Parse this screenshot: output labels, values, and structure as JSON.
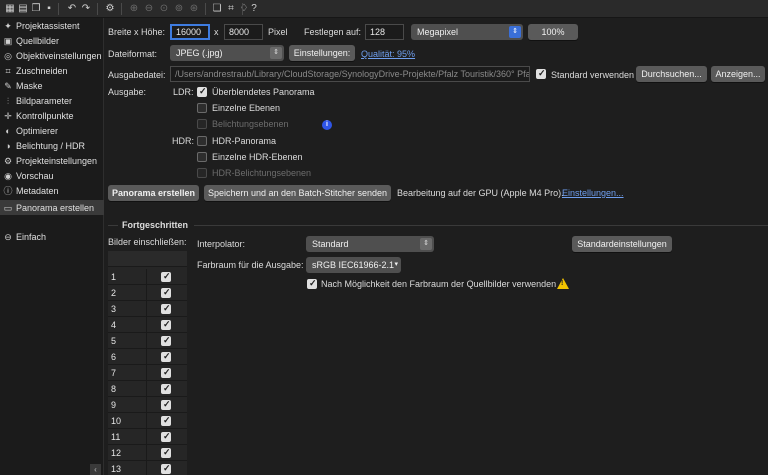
{
  "toolbar": {
    "icons": [
      "project-assistant-icon",
      "images-icon",
      "copy-icon",
      "save-icon",
      "undo-icon",
      "redo-icon",
      "settings-icon",
      "zoom-in-icon",
      "zoom-out-icon",
      "zoom-fit-icon",
      "zoom-100-icon",
      "zoom-custom-icon",
      "window-icon",
      "crop-icon",
      "hint-icon",
      "help-icon"
    ]
  },
  "sidebar": {
    "items": [
      {
        "label": "Projektassistent",
        "icon": "wand-icon",
        "glyph": "✦"
      },
      {
        "label": "Quellbilder",
        "icon": "images-icon",
        "glyph": "▣"
      },
      {
        "label": "Objektiveinstellungen",
        "icon": "lens-icon",
        "glyph": "◎"
      },
      {
        "label": "Zuschneiden",
        "icon": "crop-icon",
        "glyph": "⌗"
      },
      {
        "label": "Maske",
        "icon": "brush-icon",
        "glyph": "✎"
      },
      {
        "label": "Bildparameter",
        "icon": "sliders-icon",
        "glyph": "⫶"
      },
      {
        "label": "Kontrollpunkte",
        "icon": "crosshair-icon",
        "glyph": "✛"
      },
      {
        "label": "Optimierer",
        "icon": "optimizer-icon",
        "glyph": "◐"
      },
      {
        "label": "Belichtung / HDR",
        "icon": "exposure-icon",
        "glyph": "◑"
      },
      {
        "label": "Projekteinstellungen",
        "icon": "gear-icon",
        "glyph": "⚙"
      },
      {
        "label": "Vorschau",
        "icon": "eye-icon",
        "glyph": "◉"
      },
      {
        "label": "Metadaten",
        "icon": "info-icon",
        "glyph": "ⓘ"
      },
      {
        "label": "Panorama erstellen",
        "icon": "panorama-icon",
        "glyph": "▭"
      }
    ],
    "mode_label": "Einfach",
    "mode_glyph": "⊖"
  },
  "size": {
    "label": "Breite x Höhe:",
    "width": "16000",
    "x": "x",
    "height": "8000",
    "unit": "Pixel",
    "fix_label": "Festlegen auf:",
    "fix_value": "128",
    "megapixel_select": "Megapixel",
    "percent": "100%"
  },
  "format": {
    "label": "Dateiformat:",
    "value": "JPEG (.jpg)",
    "settings_button": "Einstellungen:",
    "quality_link": "Qualität: 95%"
  },
  "output_file": {
    "label": "Ausgabedatei:",
    "path": "/Users/andrestraub/Library/CloudStorage/SynologyDrive-Projekte/Pfalz Touristik/360° Pfal",
    "use_default": "Standard verwenden",
    "browse_button": "Durchsuchen...",
    "show_button": "Anzeigen..."
  },
  "output": {
    "label": "Ausgabe:",
    "ldr_label": "LDR:",
    "ldr": [
      {
        "label": "Überblendetes Panorama",
        "checked": true,
        "disabled": false
      },
      {
        "label": "Einzelne Ebenen",
        "checked": false,
        "disabled": false
      },
      {
        "label": "Belichtungsebenen",
        "checked": false,
        "disabled": true
      }
    ],
    "hdr_label": "HDR:",
    "hdr": [
      {
        "label": "HDR-Panorama",
        "checked": false,
        "disabled": false
      },
      {
        "label": "Einzelne HDR-Ebenen",
        "checked": false,
        "disabled": false
      },
      {
        "label": "HDR-Belichtungsebenen",
        "checked": false,
        "disabled": true
      }
    ]
  },
  "actions": {
    "create_button": "Panorama erstellen",
    "batch_button": "Speichern und an den Batch-Stitcher senden",
    "gpu_text": "Bearbeitung auf der GPU (Apple M4 Pro).",
    "gpu_link": "Einstellungen..."
  },
  "advanced": {
    "title": "Fortgeschritten",
    "include_label": "Bilder einschließen:",
    "interpolator_label": "Interpolator:",
    "interpolator_value": "Standard",
    "defaults_button": "Standardeinstellungen",
    "colorspace_label": "Farbraum für die Ausgabe:",
    "colorspace_value": "sRGB IEC61966-2.1",
    "source_colorspace": "Nach Möglichkeit den Farbraum der Quellbilder verwenden"
  },
  "images": {
    "rows": [
      "1",
      "2",
      "3",
      "4",
      "5",
      "6",
      "7",
      "8",
      "9",
      "10",
      "11",
      "12",
      "13"
    ]
  },
  "colors": {
    "accent": "#3e7ce0",
    "link": "#6f9ff0",
    "info": "#2f55e6",
    "warning": "#f2c300"
  }
}
